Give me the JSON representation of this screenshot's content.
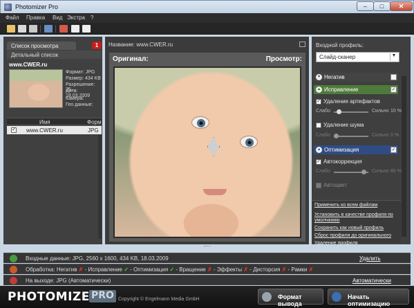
{
  "window": {
    "title": "Photomizer Pro",
    "min": "–",
    "max": "□",
    "close": "✕"
  },
  "menu": [
    "Файл",
    "Правка",
    "Вид",
    "Экстра",
    "?"
  ],
  "colors": {
    "accent_green": "#4e7b3a",
    "accent_blue": "#2f4c85",
    "badge_red": "#c61d1d"
  },
  "left": {
    "tab_label": "Список просмотра",
    "badge_count": "1",
    "detail_label": "Детальный список",
    "thumb_title": "www.CWER.ru",
    "meta": [
      "Формат: JPG",
      "Размер: 434 KB",
      "Разрешение: 25...",
      "Дата: 18.03.2009",
      "Камера:",
      "Гео данные:"
    ],
    "columns": [
      "Имя",
      "Форм"
    ],
    "rows": [
      {
        "name": "www.CWER.ru",
        "format": "JPG"
      }
    ]
  },
  "center": {
    "name_label": "Название: www.CWER.ru",
    "original_label": "Оригинал:",
    "view_label": "Просмотр:"
  },
  "right": {
    "input_profile_label": "Входной профиль:",
    "input_profile_value": "Слайд-сканер",
    "sections": {
      "negative": "Негатив",
      "correction": "Исправление",
      "optimization": "Оптимизация"
    },
    "options": {
      "remove_artifacts": "Удаление артефактов",
      "remove_noise": "Удаление шума",
      "autocorrection": "Автокоррекция",
      "autocolor": "Автоцвет"
    },
    "slider_low": "Слабо",
    "slider_high": "Сильно",
    "values": {
      "artifacts": "10 %",
      "noise": "0 %",
      "autocorrection": "80 %"
    },
    "links": [
      "Применить ко всем файлам",
      "Установить в качестве профиля по",
      "умолчанию",
      "Сохранить как новый профиль",
      "Сброс профиля до оригинального",
      "Удаление профиля"
    ]
  },
  "status": {
    "input": "Входные данные: JPG, 2560 x 1600, 434 KB, 18.03.2009",
    "input_link": "Удалить",
    "processing_prefix": "Обработка:",
    "processing": [
      {
        "label": "Негатив",
        "ok": false
      },
      {
        "label": "Исправление",
        "ok": true
      },
      {
        "label": "Оптимизация",
        "ok": true
      },
      {
        "label": "Вращение",
        "ok": false
      },
      {
        "label": "Эффекты",
        "ok": false
      },
      {
        "label": "Дисторсия",
        "ok": false
      },
      {
        "label": "Рамки",
        "ok": false
      }
    ],
    "output": "На выходе: JPG (Автоматически)",
    "output_link": "Автоматически"
  },
  "footer": {
    "logo": "PHOTOMIZER",
    "logo_pro": "PRO",
    "copyright": "Copyright © Engelmann Media GmbH",
    "format_button": "Формат вывода",
    "start_button": "Начать оптимизацию"
  }
}
